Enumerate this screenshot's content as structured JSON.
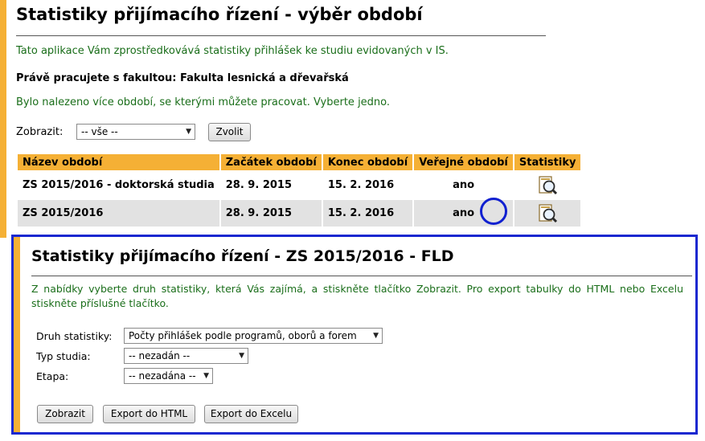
{
  "page": {
    "title": "Statistiky přijímacího řízení - výběr období",
    "intro": "Tato aplikace Vám zprostředkovává statistiky přihlášek ke studiu evidovaných v IS.",
    "faculty_line": "Právě pracujete s fakultou: Fakulta lesnická a dřevařská",
    "found_text": "Bylo nalezeno více období, se kterými můžete pracovat. Vyberte jedno.",
    "filter": {
      "label": "Zobrazit:",
      "selected": "-- vše --",
      "button": "Zvolit"
    }
  },
  "table": {
    "headers": [
      "Název období",
      "Začátek období",
      "Konec období",
      "Veřejné období",
      "Statistiky"
    ],
    "rows": [
      {
        "name": "ZS 2015/2016 - doktorská studia",
        "start": "28. 9. 2015",
        "end": "15. 2. 2016",
        "public": "ano"
      },
      {
        "name": "ZS 2015/2016",
        "start": "28. 9. 2015",
        "end": "15. 2. 2016",
        "public": "ano"
      }
    ],
    "icon": "magnifier-document-icon"
  },
  "panel": {
    "title": "Statistiky přijímacího řízení - ZS 2015/2016 - FLD",
    "instructions": "Z nabídky vyberte druh statistiky, která Vás zajímá, a stiskněte tlačítko Zobrazit. Pro export tabulky do HTML nebo Excelu stiskněte příslušné tlačítko.",
    "fields": {
      "stat_type": {
        "label": "Druh statistiky:",
        "selected": "Počty přihlášek podle programů, oborů a forem"
      },
      "study_type": {
        "label": "Typ studia:",
        "selected": "-- nezadán --"
      },
      "stage": {
        "label": "Etapa:",
        "selected": "-- nezadána --"
      }
    },
    "buttons": {
      "show": "Zobrazit",
      "export_html": "Export do HTML",
      "export_excel": "Export do Excelu"
    }
  },
  "colors": {
    "accent_orange": "#f5b035",
    "text_green": "#1a6e1a",
    "highlight_blue": "#1a28d0",
    "row_gray": "#e2e2e2"
  }
}
